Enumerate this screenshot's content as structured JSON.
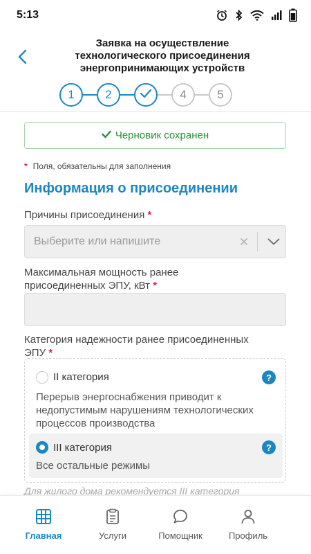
{
  "status_bar": {
    "time": "5:13"
  },
  "header": {
    "title_lines": [
      "Заявка на осуществление",
      "технологического присоединения",
      "энергопринимающих устройств"
    ],
    "steps": [
      {
        "label": "1",
        "state": "done"
      },
      {
        "label": "2",
        "state": "done"
      },
      {
        "label": "",
        "icon": "check-icon",
        "state": "current"
      },
      {
        "label": "4",
        "state": "pending"
      },
      {
        "label": "5",
        "state": "pending"
      }
    ]
  },
  "form": {
    "saved_banner": "Черновик сохранен",
    "required_note": "Поля, обязательны для заполнения",
    "section_title": "Информация о присоединении",
    "reasons": {
      "label": "Причины присоединения",
      "placeholder": "Выберите или напишите"
    },
    "max_power": {
      "label_line1": "Максимальная мощность ранее",
      "label_line2": "присоединенных ЭПУ, кВт",
      "value": ""
    },
    "reliability": {
      "label_line1": "Категория надежности ранее присоединенных",
      "label_line2": "ЭПУ",
      "options": [
        {
          "title": "II категория",
          "desc_lines": [
            "Перерыв энергоснабжения приводит к",
            "недопустимым нарушениям технологических",
            "процессов производства"
          ],
          "selected": false
        },
        {
          "title": "III категория",
          "desc_lines": [
            "Все остальные режимы"
          ],
          "selected": true
        }
      ],
      "hint": "Для жилого дома рекомендуется III категория"
    },
    "asterisk": "*",
    "help_glyph": "?"
  },
  "bottom_nav": {
    "items": [
      {
        "label": "Главная",
        "icon": "home-grid-icon",
        "active": true
      },
      {
        "label": "Услуги",
        "icon": "clipboard-icon",
        "active": false
      },
      {
        "label": "Помощник",
        "icon": "chat-bubble-icon",
        "active": false
      },
      {
        "label": "Профиль",
        "icon": "person-icon",
        "active": false
      }
    ]
  },
  "colors": {
    "accent": "#1a87c2",
    "success": "#2e8b3a",
    "required": "#d9233b"
  }
}
